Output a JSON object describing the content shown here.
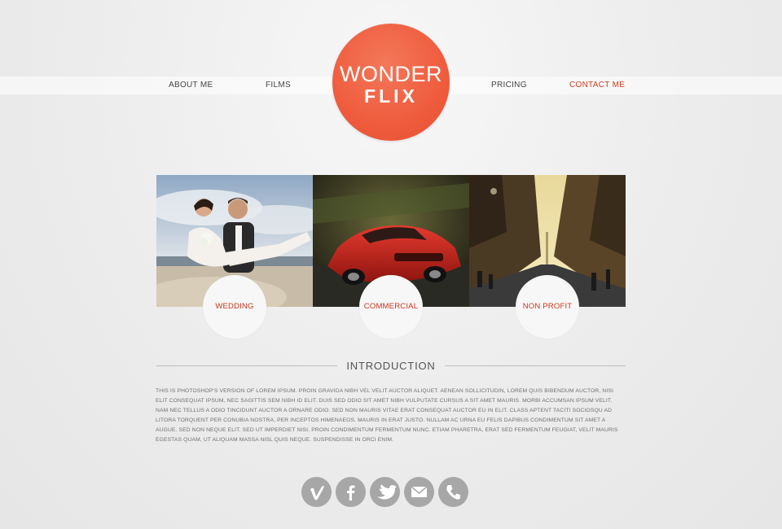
{
  "brand": {
    "line1": "WONDER",
    "line2": "FLIX",
    "color": "#ef5c3d"
  },
  "nav": [
    {
      "label": "ABOUT ME",
      "active": false
    },
    {
      "label": "FILMS",
      "active": false
    },
    {
      "label": "PRICING",
      "active": false
    },
    {
      "label": "CONTACT ME",
      "active": true
    }
  ],
  "categories": [
    {
      "label": "WEDDING",
      "image": "wedding couple photo"
    },
    {
      "label": "COMMERCIAL",
      "image": "red sports car photo"
    },
    {
      "label": "NON PROFIT",
      "image": "city street photo"
    }
  ],
  "intro": {
    "title": "INTRODUCTION",
    "body": "THIS IS PHOTOSHOP'S VERSION  OF LOREM IPSUM. PROIN GRAVIDA NIBH VEL VELIT AUCTOR ALIQUET. AENEAN SOLLICITUDIN, LOREM QUIS BIBENDUM AUCTOR, NISI ELIT CONSEQUAT IPSUM, NEC SAGITTIS SEM NIBH ID ELIT. DUIS SED ODIO SIT AMET NIBH VULPUTATE CURSUS A SIT AMET MAURIS. MORBI ACCUMSAN IPSUM VELIT. NAM NEC TELLUS A ODIO TINCIDUNT AUCTOR A ORNARE ODIO. SED NON  MAURIS VITAE ERAT CONSEQUAT AUCTOR EU IN ELIT. CLASS APTENT TACITI SOCIOSQU AD LITORA TORQUENT PER CONUBIA NOSTRA, PER INCEPTOS HIMENAEOS. MAURIS IN ERAT JUSTO. NULLAM AC URNA EU FELIS DAPIBUS CONDIMENTUM SIT AMET A AUGUE. SED NON NEQUE ELIT. SED UT IMPERDIET NISI. PROIN CONDIMENTUM FERMENTUM NUNC. ETIAM PHARETRA, ERAT SED FERMENTUM FEUGIAT, VELIT MAURIS EGESTAS QUAM, UT ALIQUAM MASSA NISL QUIS NEQUE. SUSPENDISSE IN ORCI ENIM."
  },
  "social": [
    {
      "icon": "vimeo-icon"
    },
    {
      "icon": "facebook-icon"
    },
    {
      "icon": "twitter-icon"
    },
    {
      "icon": "email-icon"
    },
    {
      "icon": "phone-icon"
    }
  ],
  "colors": {
    "accent": "#d23a1f",
    "social_bg": "#a7a7a7",
    "background": "#ececec"
  }
}
